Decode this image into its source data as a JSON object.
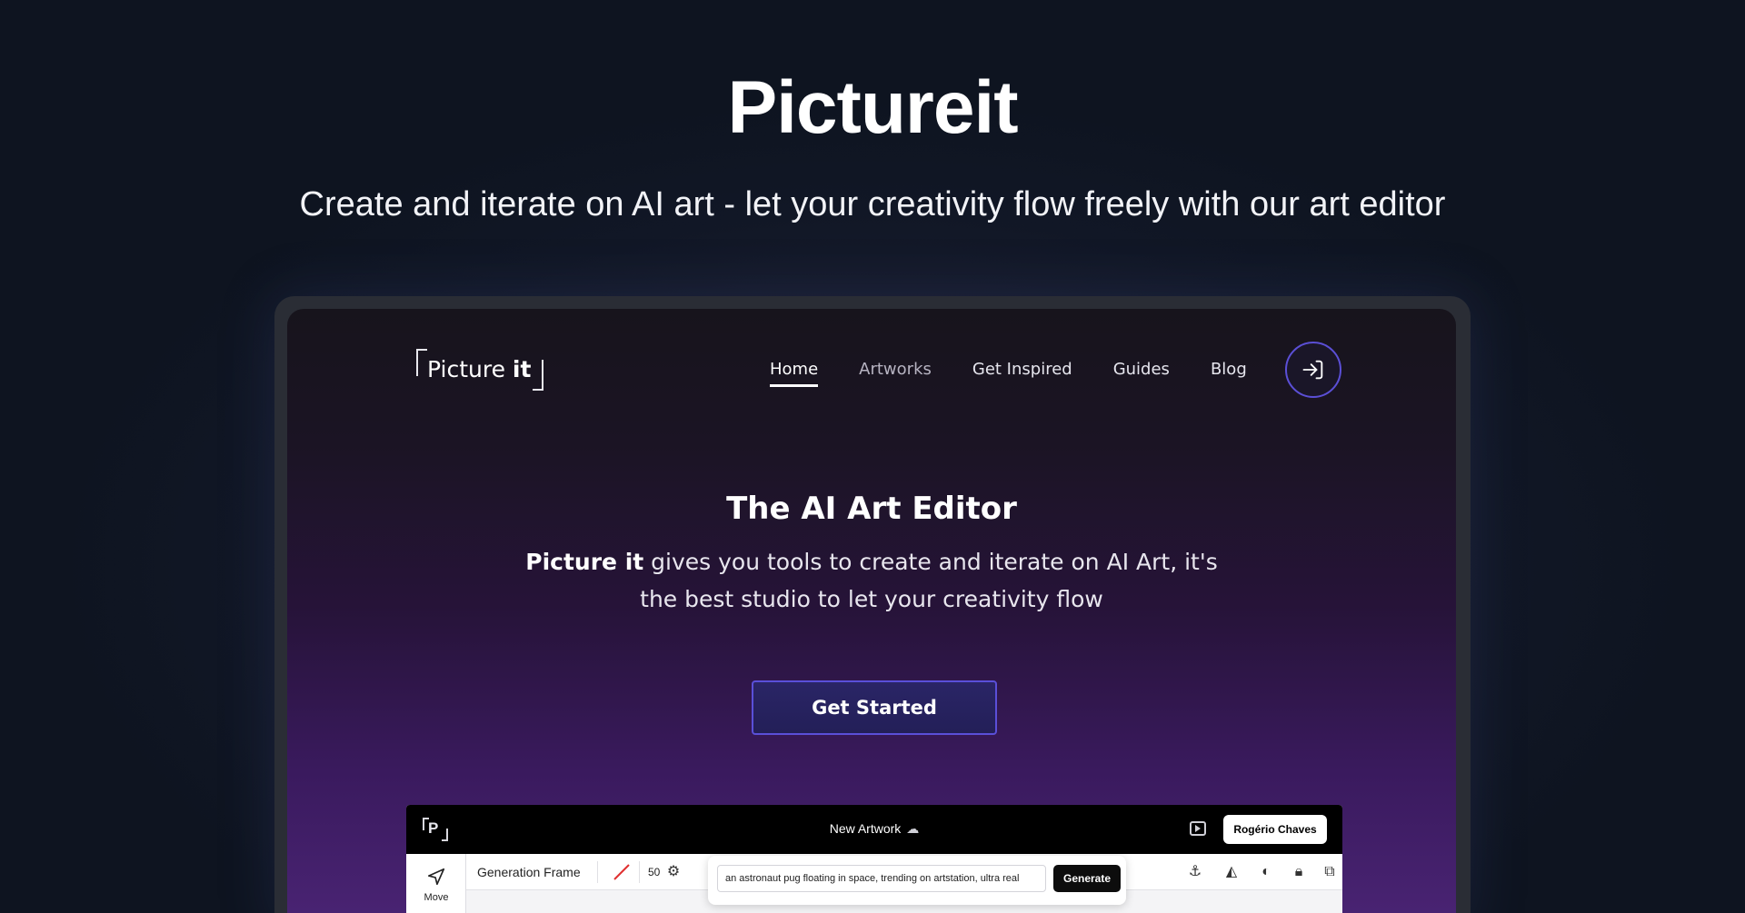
{
  "hero": {
    "title": "Pictureit",
    "subtitle": "Create and iterate on AI art - let your creativity flow freely with our art editor"
  },
  "site": {
    "logo": {
      "text_regular": "Picture ",
      "text_bold": "it"
    },
    "nav": [
      {
        "label": "Home",
        "active": true
      },
      {
        "label": "Artworks",
        "active": false
      },
      {
        "label": "Get Inspired",
        "active": false
      },
      {
        "label": "Guides",
        "active": false
      },
      {
        "label": "Blog",
        "active": false
      }
    ],
    "login_icon": "login-arrow-icon",
    "section_title": "The AI Art Editor",
    "section_desc_bold": "Picture it",
    "section_desc_rest": " gives you tools to create and iterate on AI Art, it's the best studio to let your creativity flow",
    "cta_label": "Get Started"
  },
  "app": {
    "logo_letter": "P",
    "title": "New Artwork",
    "user_name": "Rogério Chaves",
    "tool_label": "Move",
    "toolbar_label": "Generation Frame",
    "toolbar_number": "50",
    "prompt_value": "an astronaut pug floating in space, trending on artstation, ultra real",
    "generate_label": "Generate"
  },
  "colors": {
    "accent": "#5b4fd6",
    "cta_bg": "#2a2566"
  }
}
